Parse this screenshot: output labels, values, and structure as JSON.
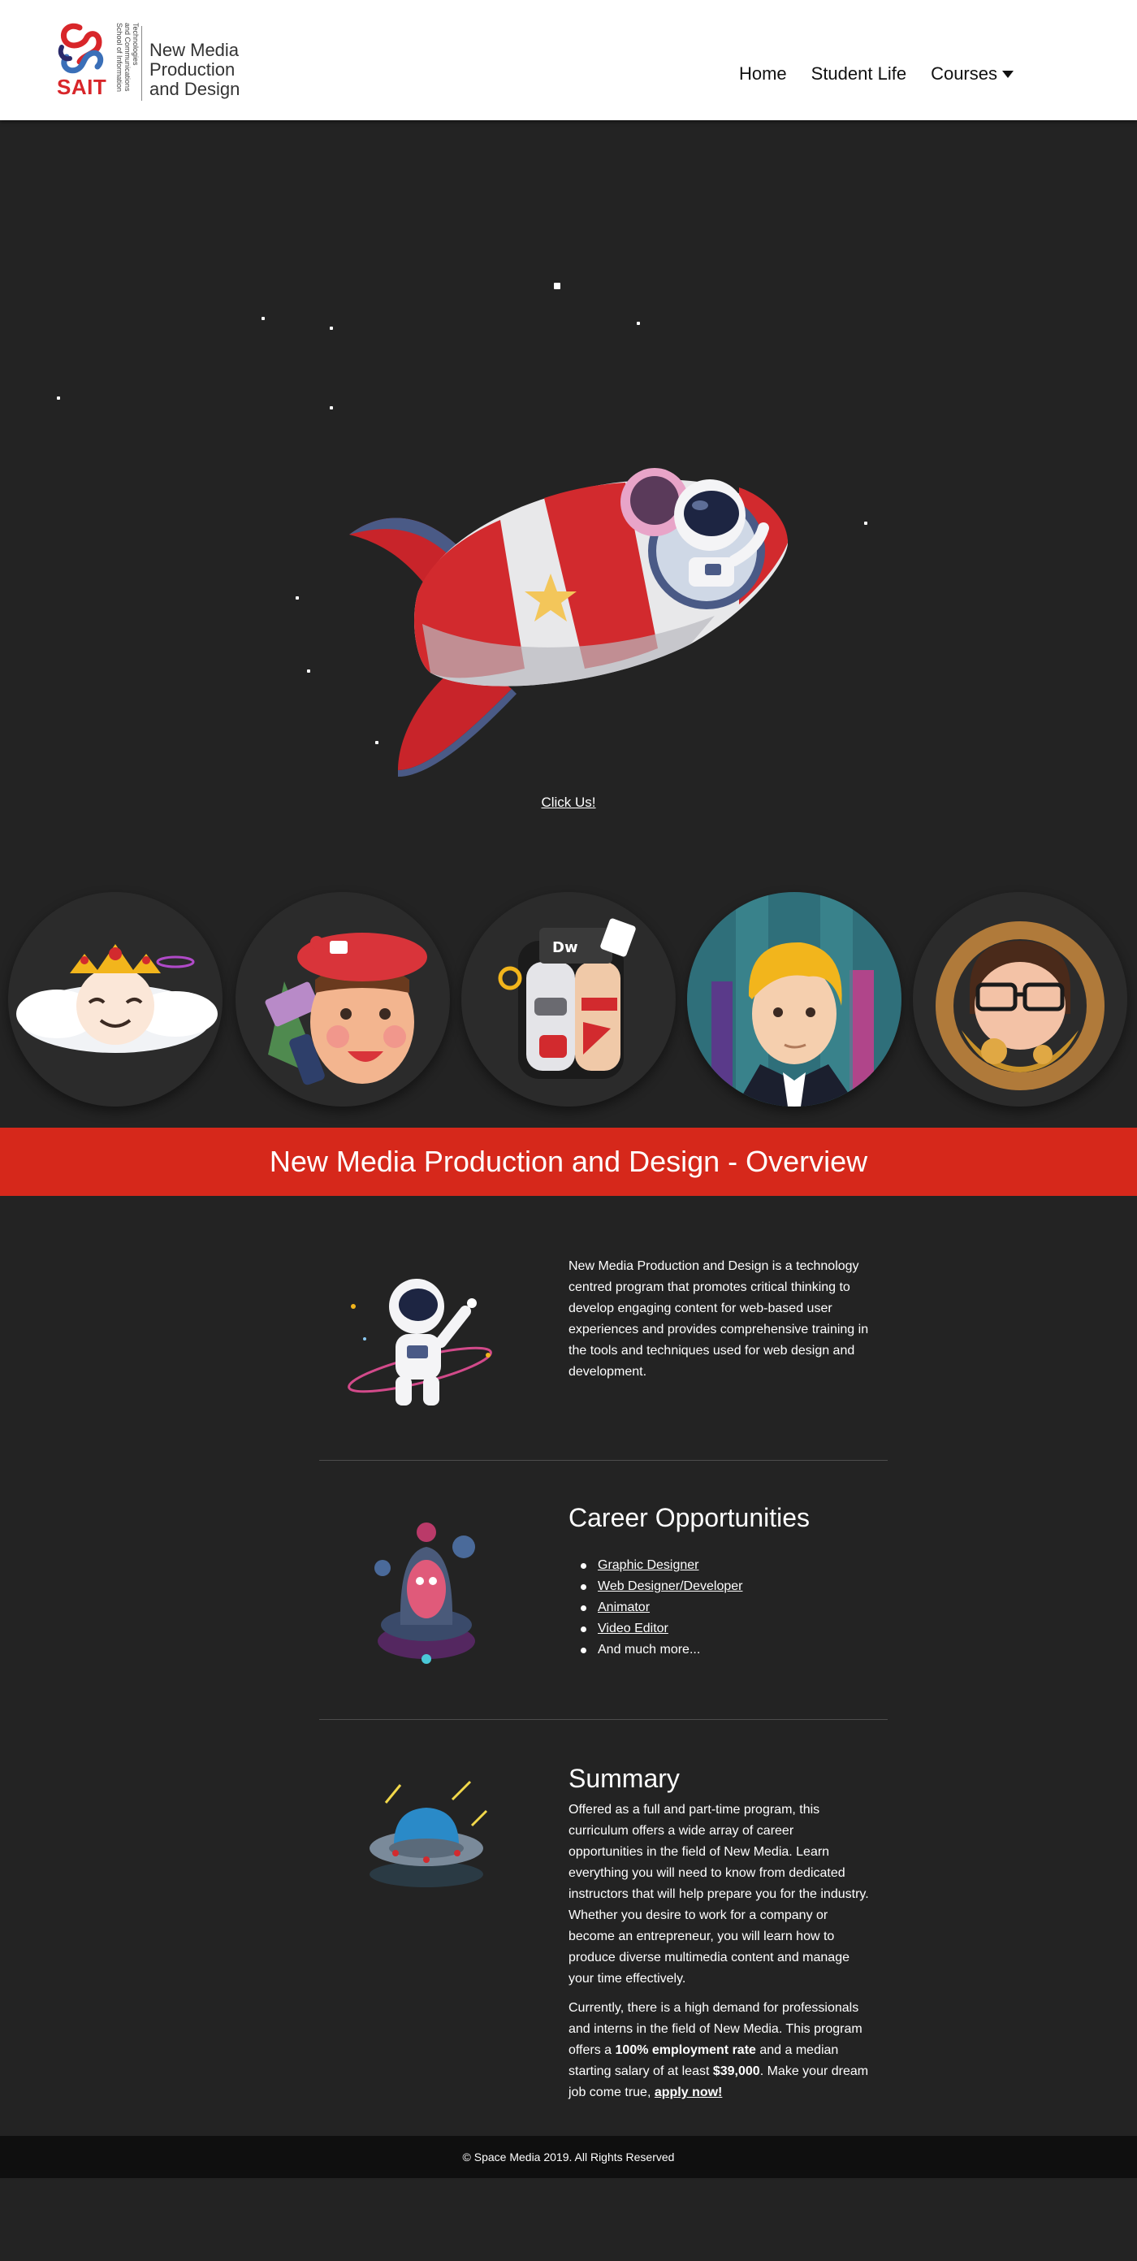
{
  "header": {
    "logo": {
      "wordmark": "SAIT",
      "school_lines": [
        "School of Information",
        "and Communications",
        "Technologies"
      ],
      "program_lines": [
        "New Media",
        "Production",
        "and Design"
      ]
    },
    "nav": [
      {
        "label": "Home"
      },
      {
        "label": "Student Life"
      },
      {
        "label": "Courses",
        "has_dropdown": true
      }
    ]
  },
  "hero": {
    "cta_label": "Click Us!"
  },
  "avatars": [
    {
      "name": "cloud-king-avatar"
    },
    {
      "name": "artist-beret-avatar"
    },
    {
      "name": "robot-split-avatar"
    },
    {
      "name": "blonde-cityscape-avatar"
    },
    {
      "name": "steampunk-glasses-avatar"
    }
  ],
  "overview": {
    "title": "New Media Production and Design - Overview",
    "intro": "New Media Production and Design is a technology centred program that promotes critical thinking to develop engaging content for web-based user experiences and provides comprehensive training in the tools and techniques used for web design and development.",
    "careers": {
      "title": "Career Opportunities",
      "items": [
        "Graphic Designer",
        "Web Designer/Developer",
        "Animator",
        "Video Editor"
      ],
      "more": "And much more..."
    },
    "summary": {
      "title": "Summary",
      "paragraph1": "Offered as a full and part-time program, this curriculum offers a wide array of career opportunities in the field of New Media. Learn everything you will need to know from dedicated instructors that will help prepare you for the industry. Whether you desire to work for a company or become an entrepreneur, you will learn how to produce diverse multimedia content and manage your time effectively.",
      "p2_part1": "Currently, there is a high demand for professionals and interns in the field of New Media. This program offers a ",
      "p2_bold1": "100% employment rate",
      "p2_part2": " and a median starting salary of at least ",
      "p2_bold2": "$39,000",
      "p2_part3": ". Make your dream job come true, ",
      "p2_link": "apply now!"
    }
  },
  "footer": {
    "copyright": "© Space Media 2019. All Rights Reserved"
  },
  "colors": {
    "banner_red": "#d6281b",
    "page_bg": "#232323",
    "footer_bg": "#0f0f0f"
  }
}
